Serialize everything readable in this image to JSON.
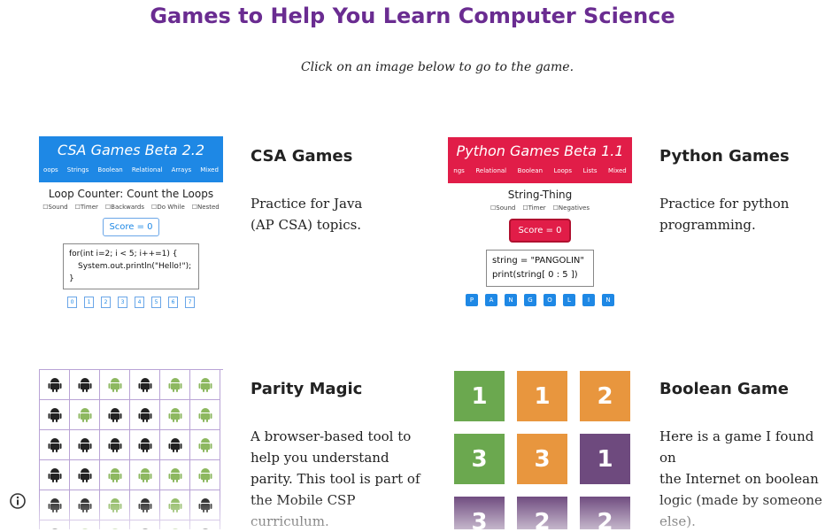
{
  "page": {
    "title": "Games to Help You Learn Computer Science",
    "subtitle": "Click on an image below to go to the game."
  },
  "cards": {
    "csa": {
      "title": "CSA Games",
      "desc_lines": [
        "Practice for Java",
        "(AP CSA) topics."
      ],
      "thumb": {
        "banner_title": "CSA Games Beta 2.2",
        "nav": [
          "oops",
          "Strings",
          "Boolean",
          "Relational",
          "Arrays",
          "Mixed"
        ],
        "heading": "Loop Counter: Count the Loops",
        "options": [
          "Sound",
          "Timer",
          "Backwards",
          "Do While",
          "Nested"
        ],
        "score": "Score = 0",
        "code": [
          "for(int i=2; i < 5; i++=1) {",
          "System.out.println(\"Hello!\");",
          "}"
        ],
        "buttons": [
          "0",
          "1",
          "2",
          "3",
          "4",
          "5",
          "6",
          "7"
        ],
        "color": "#1e88e5"
      }
    },
    "python": {
      "title": "Python Games",
      "desc_lines": [
        "Practice for python",
        "programming."
      ],
      "thumb": {
        "banner_title": "Python Games Beta 1.1",
        "nav": [
          "ngs",
          "Relational",
          "Boolean",
          "Loops",
          "Lists",
          "Mixed"
        ],
        "heading": "String-Thing",
        "options": [
          "Sound",
          "Timer",
          "Negatives"
        ],
        "score": "Score = 0",
        "code": [
          "string = \"PANGOLIN\"",
          "print(string[ 0 : 5 ])"
        ],
        "buttons": [
          "P",
          "A",
          "N",
          "G",
          "O",
          "L",
          "I",
          "N"
        ],
        "color": "#e11d48"
      }
    },
    "parity": {
      "title": "Parity Magic",
      "desc_lines": [
        "A browser-based tool to",
        "help you understand",
        "parity. This tool is part of",
        "the Mobile CSP",
        "curriculum."
      ],
      "thumb": {
        "rows": [
          [
            "black",
            "black",
            "green",
            "black",
            "green",
            "green"
          ],
          [
            "black",
            "green",
            "black",
            "black",
            "green",
            "green"
          ],
          [
            "black",
            "black",
            "black",
            "black",
            "black",
            "green"
          ],
          [
            "black",
            "black",
            "green",
            "green",
            "green",
            "green"
          ],
          [
            "black",
            "black",
            "green",
            "black",
            "green",
            "black"
          ],
          [
            "black",
            "green",
            "green",
            "black",
            "green",
            "black"
          ]
        ],
        "icon": "android-icon",
        "colors": {
          "black": "#222222",
          "green": "#8db860"
        }
      }
    },
    "boolean": {
      "title": "Boolean Game",
      "desc_lines": [
        "Here is a game I found on",
        "the Internet on boolean",
        "logic (made by someone",
        "else)."
      ],
      "thumb": {
        "tiles": [
          {
            "n": "1",
            "c": "green"
          },
          {
            "n": "1",
            "c": "orange"
          },
          {
            "n": "2",
            "c": "orange"
          },
          {
            "n": "3",
            "c": "green"
          },
          {
            "n": "3",
            "c": "orange"
          },
          {
            "n": "1",
            "c": "purple"
          },
          {
            "n": "3",
            "c": "purple"
          },
          {
            "n": "2",
            "c": "purple"
          },
          {
            "n": "2",
            "c": "purple"
          }
        ],
        "colors": {
          "green": "#6ba84f",
          "orange": "#e8963e",
          "purple": "#6e4a7e"
        }
      }
    }
  },
  "footer": {
    "icon": "info-icon"
  }
}
